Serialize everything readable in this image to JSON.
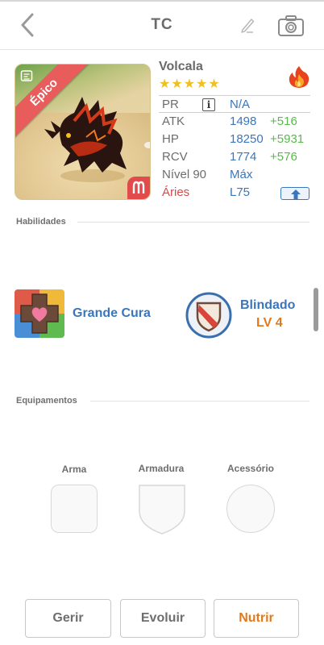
{
  "header": {
    "title": "TC",
    "back_icon": "chevron-left-icon",
    "edit_icon": "pencil-icon",
    "camera_icon": "camera-icon"
  },
  "dragon": {
    "name": "Volcala",
    "rarity_label": "Épico",
    "stars": [
      "★",
      "★",
      "★",
      "★",
      "★"
    ],
    "element_icon": "fire-icon",
    "sign_icon": "aries-symbol-icon"
  },
  "stats": {
    "pr": {
      "label": "PR",
      "value": "N/A",
      "info_glyph": "i"
    },
    "atk": {
      "label": "ATK",
      "value": "1498",
      "bonus": "+516"
    },
    "hp": {
      "label": "HP",
      "value": "18250",
      "bonus": "+5931"
    },
    "rcv": {
      "label": "RCV",
      "value": "1774",
      "bonus": "+576"
    },
    "level": {
      "label": "Nível 90",
      "value": "Máx"
    },
    "sign": {
      "label": "Áries",
      "value": "L75",
      "upgrade_icon": "arrow-up-icon"
    }
  },
  "skills": {
    "section_label": "Habilidades",
    "leader": {
      "name": "Grande Cura",
      "icon": "heart-cross-icon"
    },
    "passive": {
      "name": "Blindado",
      "level": "LV 4",
      "icon": "shield-icon"
    }
  },
  "equipment": {
    "section_label": "Equipamentos",
    "slots": [
      {
        "label": "Arma"
      },
      {
        "label": "Armadura"
      },
      {
        "label": "Acessório"
      }
    ]
  },
  "actions": {
    "manage": "Gerir",
    "evolve": "Evoluir",
    "feed": "Nutrir"
  },
  "colors": {
    "stat_value": "#3a76bd",
    "stat_bonus": "#5ab84e",
    "rarity_ribbon": "#e85c5c",
    "feed_accent": "#e07a1e",
    "star": "#f0c020"
  }
}
